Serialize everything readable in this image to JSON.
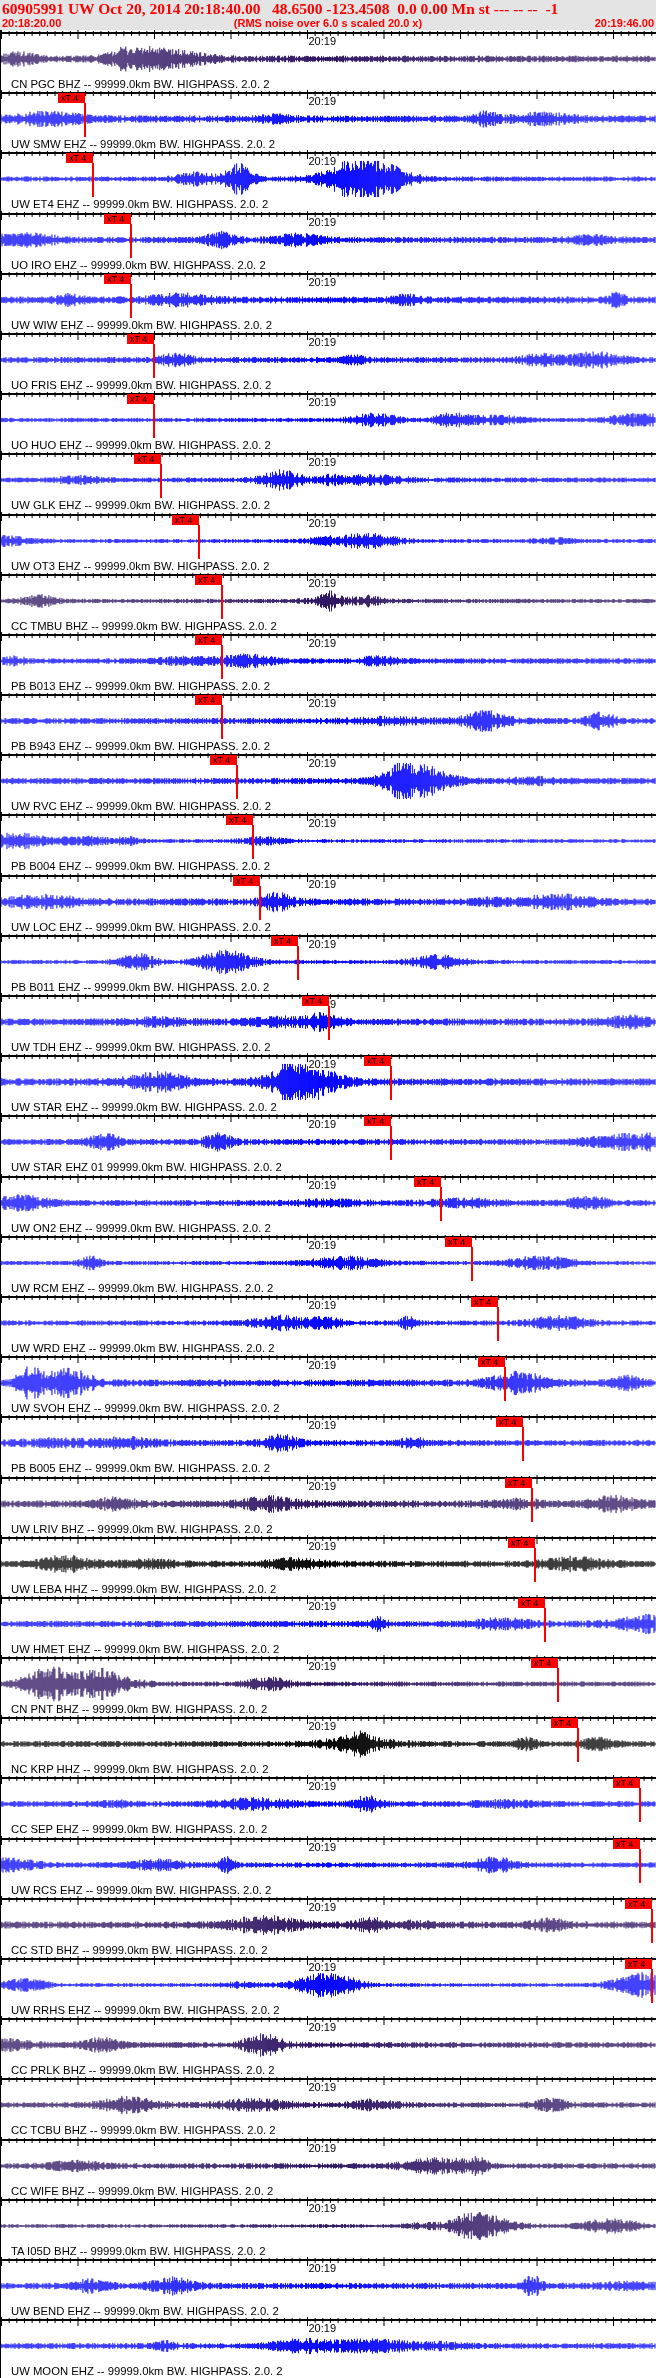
{
  "header": {
    "event": "60905991 UW Oct 20, 2014 20:18:40.00   48.6500 -123.4508  0.0 0.00 Mn st --- -- --  -1",
    "start_time": "20:18:20.00",
    "note": "(RMS noise over 6.0 s scaled 20.0 x)",
    "end_time": "20:19:46.00"
  },
  "traces": [
    {
      "label": "CN PGC BHZ -- 99999.0km BW. HIGHPASS. 2.0. 2",
      "color": "#2a1060",
      "tick_label": "20:19"
    },
    {
      "label": "UW SMW EHZ -- 99999.0km BW. HIGHPASS. 2.0. 2",
      "color": "#0000ff",
      "tick_label": "20:19",
      "pick": "xT 4"
    },
    {
      "label": "UW ET4 EHZ -- 99999.0km BW. HIGHPASS. 2.0. 2",
      "color": "#0000ff",
      "tick_label": "20:19",
      "pick": "xT 4"
    },
    {
      "label": "UO IRO EHZ -- 99999.0km BW. HIGHPASS. 2.0. 2",
      "color": "#0000ff",
      "tick_label": "20:19",
      "pick": "xT 4"
    },
    {
      "label": "UW WIW EHZ -- 99999.0km BW. HIGHPASS. 2.0. 2",
      "color": "#0000ff",
      "tick_label": "20:19",
      "pick": "xT 4"
    },
    {
      "label": "UO FRIS EHZ -- 99999.0km BW. HIGHPASS. 2.0. 2",
      "color": "#0000ff",
      "tick_label": "20:19",
      "pick": "xT 4"
    },
    {
      "label": "UO HUO EHZ -- 99999.0km BW. HIGHPASS. 2.0. 2",
      "color": "#0000ff",
      "tick_label": "20:19",
      "pick": "xT 4"
    },
    {
      "label": "UW GLK EHZ -- 99999.0km BW. HIGHPASS. 2.0. 2",
      "color": "#0000ff",
      "tick_label": "20:19",
      "pick": "xT 4"
    },
    {
      "label": "UW OT3 EHZ -- 99999.0km BW. HIGHPASS. 2.0. 2",
      "color": "#0000ff",
      "tick_label": "20:19",
      "pick": "xT 4"
    },
    {
      "label": "CC TMBU BHZ -- 99999.0km BW. HIGHPASS. 2.0. 2",
      "color": "#2a1060",
      "tick_label": "20:19",
      "pick": "xT 4"
    },
    {
      "label": "PB B013 EHZ -- 99999.0km BW. HIGHPASS. 2.0. 2",
      "color": "#0000ff",
      "tick_label": "20:19",
      "pick": "xT 4"
    },
    {
      "label": "PB B943 EHZ -- 99999.0km BW. HIGHPASS. 2.0. 2",
      "color": "#0000ff",
      "tick_label": "20:19",
      "pick": "xT 4"
    },
    {
      "label": "UW RVC EHZ -- 99999.0km BW. HIGHPASS. 2.0. 2",
      "color": "#0000ff",
      "tick_label": "20:19",
      "pick": "xT 4"
    },
    {
      "label": "PB B004 EHZ -- 99999.0km BW. HIGHPASS. 2.0. 2",
      "color": "#0000ff",
      "tick_label": "20:19",
      "pick": "xT 4"
    },
    {
      "label": "UW LOC EHZ -- 99999.0km BW. HIGHPASS. 2.0. 2",
      "color": "#0000ff",
      "tick_label": "20:19",
      "pick": "xT 4"
    },
    {
      "label": "PB B011 EHZ -- 99999.0km BW. HIGHPASS. 2.0. 2",
      "color": "#0000ff",
      "tick_label": "20:19",
      "pick": "xT 4"
    },
    {
      "label": "UW TDH EHZ -- 99999.0km BW. HIGHPASS. 2.0. 2",
      "color": "#0000ff",
      "tick_label": "9",
      "pick": "xT 4"
    },
    {
      "label": "UW STAR EHZ -- 99999.0km BW. HIGHPASS. 2.0. 2",
      "color": "#0000ff",
      "tick_label": "20:19",
      "pick": "xT 4"
    },
    {
      "label": "UW STAR EHZ 01 99999.0km BW. HIGHPASS. 2.0. 2",
      "color": "#0000ff",
      "tick_label": "20:19",
      "pick": "xT 4"
    },
    {
      "label": "UW ON2 EHZ -- 99999.0km BW. HIGHPASS. 2.0. 2",
      "color": "#0000ff",
      "tick_label": "20:19",
      "pick": "xT 4"
    },
    {
      "label": "UW RCM EHZ -- 99999.0km BW. HIGHPASS. 2.0. 2",
      "color": "#0000ff",
      "tick_label": "20:19",
      "pick": "xT 4"
    },
    {
      "label": "UW WRD EHZ -- 99999.0km BW. HIGHPASS. 2.0. 2",
      "color": "#0000ff",
      "tick_label": "20:19",
      "pick": "xT 4"
    },
    {
      "label": "UW SVOH EHZ -- 99999.0km BW. HIGHPASS. 2.0. 2",
      "color": "#0000ff",
      "tick_label": "20:19",
      "pick": "xT 4"
    },
    {
      "label": "PB B005 EHZ -- 99999.0km BW. HIGHPASS. 2.0. 2",
      "color": "#0000ff",
      "tick_label": "20:19",
      "pick": "xT 4"
    },
    {
      "label": "UW LRIV BHZ -- 99999.0km BW. HIGHPASS. 2.0. 2",
      "color": "#2a1060",
      "tick_label": "20:19",
      "pick": "xT 4"
    },
    {
      "label": "UW LEBA HHZ -- 99999.0km BW. HIGHPASS. 2.0. 2",
      "color": "#000000",
      "tick_label": "20:19",
      "pick": "xT 4"
    },
    {
      "label": "UW HMET EHZ -- 99999.0km BW. HIGHPASS. 2.0. 2",
      "color": "#0000ff",
      "tick_label": "20:19",
      "pick": "xT 4"
    },
    {
      "label": "CN PNT BHZ -- 99999.0km BW. HIGHPASS. 2.0. 2",
      "color": "#2a1060",
      "tick_label": "20:19",
      "pick": "xT 4"
    },
    {
      "label": "NC KRP HHZ -- 99999.0km BW. HIGHPASS. 2.0. 2",
      "color": "#000000",
      "tick_label": "20:19",
      "pick": "xT 4"
    },
    {
      "label": "CC SEP EHZ -- 99999.0km BW. HIGHPASS. 2.0. 2",
      "color": "#0000ff",
      "tick_label": "20:19",
      "pick": "xT 4"
    },
    {
      "label": "UW RCS EHZ -- 99999.0km BW. HIGHPASS. 2.0. 2",
      "color": "#0000ff",
      "tick_label": "20:19",
      "pick": "xT 4"
    },
    {
      "label": "CC STD BHZ -- 99999.0km BW. HIGHPASS. 2.0. 2",
      "color": "#2a1060",
      "tick_label": "20:19",
      "pick": "xT 4"
    },
    {
      "label": "UW RRHS EHZ -- 99999.0km BW. HIGHPASS. 2.0. 2",
      "color": "#0000ff",
      "tick_label": "20:19",
      "pick": "xT 4"
    },
    {
      "label": "CC PRLK BHZ -- 99999.0km BW. HIGHPASS. 2.0. 2",
      "color": "#2a1060",
      "tick_label": "20:19"
    },
    {
      "label": "CC TCBU BHZ -- 99999.0km BW. HIGHPASS. 2.0. 2",
      "color": "#2a1060",
      "tick_label": "20:19"
    },
    {
      "label": "CC WIFE BHZ -- 99999.0km BW. HIGHPASS. 2.0. 2",
      "color": "#2a1060",
      "tick_label": "20:19"
    },
    {
      "label": "TA I05D BHZ -- 99999.0km BW. HIGHPASS. 2.0. 2",
      "color": "#2a1060",
      "tick_label": "20:19"
    },
    {
      "label": "UW BEND EHZ -- 99999.0km BW. HIGHPASS. 2.0. 2",
      "color": "#0000ff",
      "tick_label": "20:19"
    },
    {
      "label": "UW MOON EHZ -- 99999.0km BW. HIGHPASS. 2.0. 2",
      "color": "#0000ff",
      "tick_label": "20:19"
    }
  ]
}
